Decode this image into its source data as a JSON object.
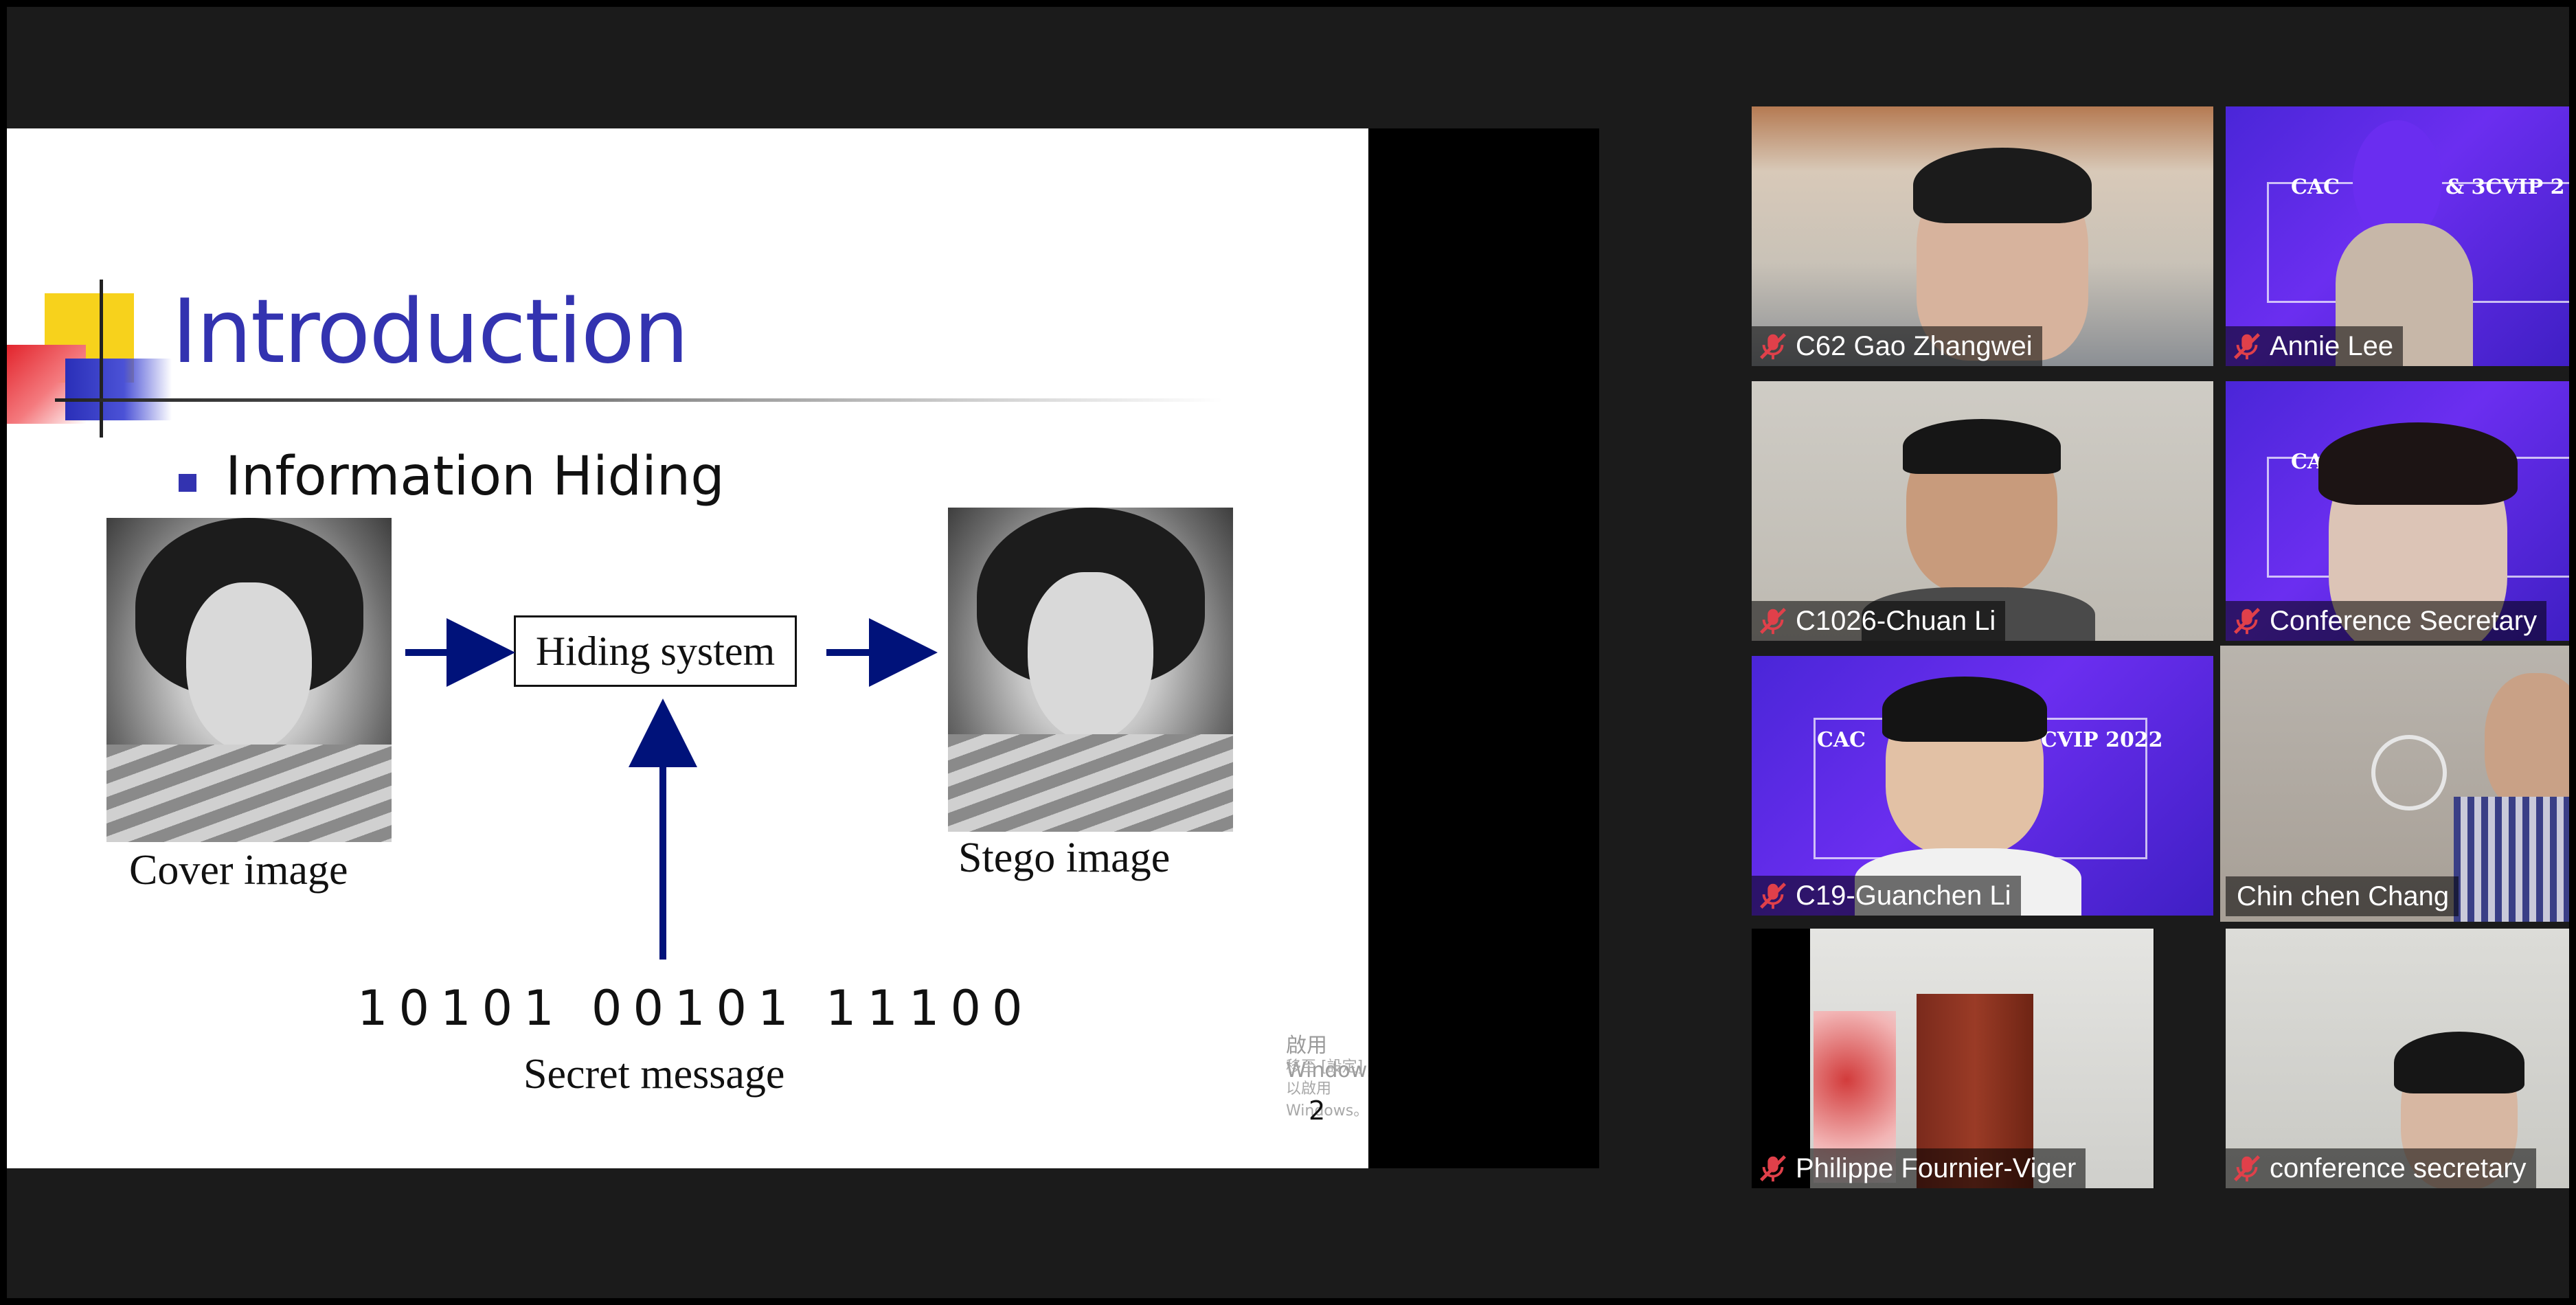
{
  "slide": {
    "title": "Introduction",
    "bullet": "Information Hiding",
    "cover_caption": "Cover image",
    "system_label": "Hiding system",
    "stego_caption": "Stego image",
    "binary": "10101 00101 11100",
    "secret_caption": "Secret message",
    "page_number": "2",
    "watermark_line1": "啟用 Windows",
    "watermark_line2": "移至 [設定] 以啟用 Windows。"
  },
  "participants": [
    {
      "name": "C62 Gao Zhangwei",
      "muted": true
    },
    {
      "name": "Annie Lee",
      "muted": true
    },
    {
      "name": "C1026-Chuan Li",
      "muted": true
    },
    {
      "name": "Conference Secretary",
      "muted": true
    },
    {
      "name": "C19-Guanchen Li",
      "muted": true
    },
    {
      "name": "Chin chen Chang",
      "muted": false,
      "active_speaker": true
    },
    {
      "name": "Philippe Fournier-Viger",
      "muted": true
    },
    {
      "name": "conference secretary",
      "muted": true
    }
  ],
  "poster": {
    "line1": "CAC",
    "line2": "& 3CVIP 2",
    "line3": "3CVIP 2022"
  },
  "colors": {
    "accent_title": "#3333b0",
    "arrow": "#00127a",
    "active_border": "#c6dd3a",
    "muted_icon": "#e0404a"
  }
}
